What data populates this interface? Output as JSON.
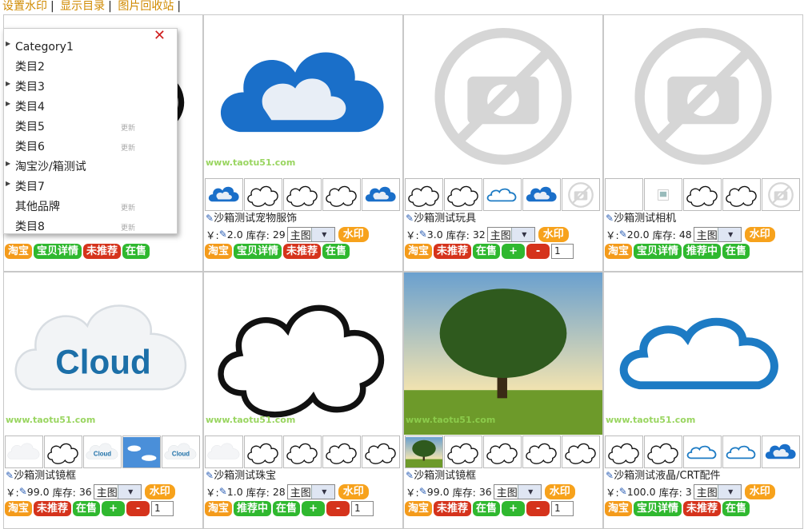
{
  "topbar": {
    "links": [
      "设置水印",
      "显示目录",
      "图片回收站"
    ]
  },
  "menu": {
    "close": "✕",
    "items": [
      {
        "label": "Category1",
        "expand": true,
        "update": ""
      },
      {
        "label": "类目2",
        "expand": false,
        "update": ""
      },
      {
        "label": "类目3",
        "expand": true,
        "update": ""
      },
      {
        "label": "类目4",
        "expand": true,
        "update": ""
      },
      {
        "label": "类目5",
        "expand": false,
        "update": "更新"
      },
      {
        "label": "类目6",
        "expand": false,
        "update": "更新"
      },
      {
        "label": "淘宝沙/箱测试",
        "expand": true,
        "update": ""
      },
      {
        "label": "类目7",
        "expand": true,
        "update": ""
      },
      {
        "label": "其他品牌",
        "expand": false,
        "update": "更新"
      },
      {
        "label": "类目8",
        "expand": false,
        "update": "更新"
      }
    ]
  },
  "watermark": "www.taotu51.com",
  "common": {
    "yen": "￥:",
    "stock": "库存:",
    "select": "主图",
    "wm_btn": "水印",
    "qty": "1"
  },
  "products": [
    {
      "title": "",
      "price": "",
      "stock": "",
      "image": "cloud-outline",
      "thumbs": [
        "cloud-blue",
        "cloud-outline"
      ],
      "buttons": [
        [
          "淘宝",
          "o"
        ],
        [
          "宝贝详情",
          "g"
        ],
        [
          "未推荐",
          "r"
        ],
        [
          "在售",
          "g"
        ]
      ]
    },
    {
      "title": "沙箱测试宠物服饰",
      "price": "2.0",
      "stock": "29",
      "image": "cloud-blue",
      "thumbs": [
        "cloud-blue",
        "cloud-outline",
        "cloud-outline",
        "cloud-outline",
        "cloud-blue"
      ],
      "buttons": [
        [
          "淘宝",
          "o"
        ],
        [
          "宝贝详情",
          "g"
        ],
        [
          "未推荐",
          "r"
        ],
        [
          "在售",
          "g"
        ]
      ]
    },
    {
      "title": "沙箱测试玩具",
      "price": "3.0",
      "stock": "32",
      "image": "nophoto",
      "thumbs": [
        "cloud-outline",
        "cloud-outline",
        "cloud-ring",
        "cloud-blue",
        "nophoto"
      ],
      "buttons": [
        [
          "淘宝",
          "o"
        ],
        [
          "未推荐",
          "r"
        ],
        [
          "在售",
          "g"
        ],
        [
          "+",
          "g"
        ],
        [
          "-",
          "r"
        ]
      ],
      "qty": true
    },
    {
      "title": "沙箱测试相机",
      "price": "20.0",
      "stock": "48",
      "image": "nophoto",
      "thumbs": [
        "empty",
        "broken",
        "cloud-outline",
        "cloud-outline",
        "nophoto"
      ],
      "buttons": [
        [
          "淘宝",
          "o"
        ],
        [
          "宝贝详情",
          "g"
        ],
        [
          "推荐中",
          "g"
        ],
        [
          "在售",
          "g"
        ]
      ]
    },
    {
      "title": "沙箱测试镜框",
      "price": "99.0",
      "stock": "36",
      "image": "cloud-text",
      "thumbs": [
        "cloud-white",
        "cloud-outline",
        "cloud-text",
        "sky",
        "cloud-text"
      ],
      "buttons": [
        [
          "淘宝",
          "o"
        ],
        [
          "未推荐",
          "r"
        ],
        [
          "在售",
          "g"
        ],
        [
          "+",
          "g"
        ],
        [
          "-",
          "r"
        ]
      ],
      "qty": true
    },
    {
      "title": "沙箱测试珠宝",
      "price": "1.0",
      "stock": "28",
      "image": "cloud-outline",
      "thumbs": [
        "cloud-white",
        "cloud-outline",
        "cloud-outline",
        "cloud-outline",
        "cloud-outline"
      ],
      "buttons": [
        [
          "淘宝",
          "o"
        ],
        [
          "推荐中",
          "g"
        ],
        [
          "在售",
          "g"
        ],
        [
          "+",
          "g"
        ],
        [
          "-",
          "r"
        ]
      ],
      "qty": true
    },
    {
      "title": "沙箱测试镜框",
      "price": "99.0",
      "stock": "36",
      "image": "tree",
      "thumbs": [
        "tree",
        "cloud-outline",
        "cloud-outline",
        "cloud-outline",
        "cloud-outline"
      ],
      "buttons": [
        [
          "淘宝",
          "o"
        ],
        [
          "未推荐",
          "r"
        ],
        [
          "在售",
          "g"
        ],
        [
          "+",
          "g"
        ],
        [
          "-",
          "r"
        ]
      ],
      "qty": true
    },
    {
      "title": "沙箱测试液晶/CRT配件",
      "price": "100.0",
      "stock": "3",
      "image": "cloud-ring",
      "thumbs": [
        "cloud-outline",
        "cloud-outline",
        "cloud-ring",
        "cloud-ring",
        "cloud-blue"
      ],
      "buttons": [
        [
          "淘宝",
          "o"
        ],
        [
          "宝贝详情",
          "g"
        ],
        [
          "未推荐",
          "r"
        ],
        [
          "在售",
          "g"
        ]
      ]
    }
  ]
}
